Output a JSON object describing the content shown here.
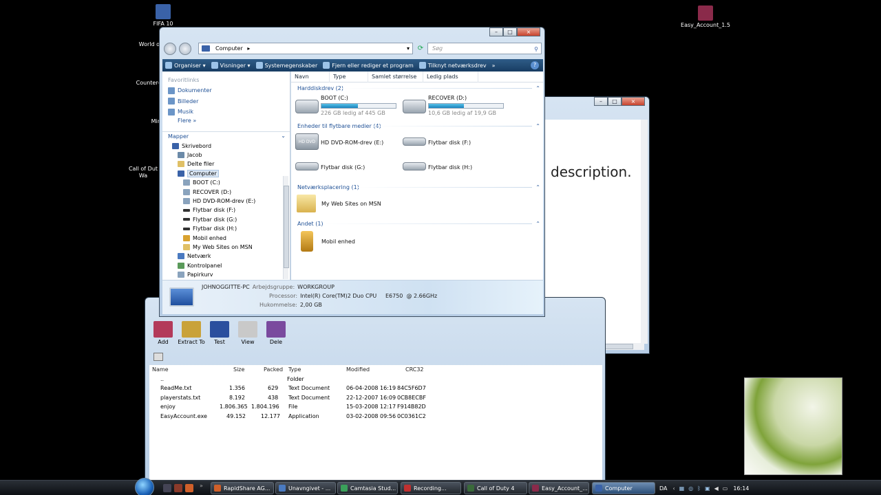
{
  "desktop": {
    "icons": [
      {
        "label": "FIFA 10",
        "color": "#3a62a8"
      },
      {
        "label": "World o",
        "color": "#6a4a22"
      },
      {
        "label": "Counter-",
        "color": "#555555"
      },
      {
        "label": "Mir",
        "color": "#334455"
      },
      {
        "label": "Call of Dut\nWa",
        "color": "#445533"
      },
      {
        "label": "Easy_Account_1.5",
        "color": "#8a2a4a"
      }
    ]
  },
  "explorer": {
    "address": "Computer",
    "search_placeholder": "Søg",
    "commands": [
      {
        "label": "Organiser ▾",
        "icon": "organize-icon"
      },
      {
        "label": "Visninger ▾",
        "icon": "views-icon"
      },
      {
        "label": "Systemegenskaber",
        "icon": "system-properties-icon"
      },
      {
        "label": "Fjern eller rediger et program",
        "icon": "uninstall-icon"
      },
      {
        "label": "Tilknyt netværksdrev",
        "icon": "map-drive-icon"
      },
      {
        "label": "»",
        "icon": "more-icon"
      }
    ],
    "nav": {
      "favorites_header": "Favoritlinks",
      "favorites": [
        "Dokumenter",
        "Billeder",
        "Musik"
      ],
      "more": "Flere  »",
      "folders_header": "Mapper",
      "tree": [
        {
          "label": "Skrivebord",
          "indent": 0
        },
        {
          "label": "Jacob",
          "indent": 1
        },
        {
          "label": "Delte filer",
          "indent": 1
        },
        {
          "label": "Computer",
          "indent": 1,
          "selected": true
        },
        {
          "label": "BOOT (C:)",
          "indent": 2
        },
        {
          "label": "RECOVER (D:)",
          "indent": 2
        },
        {
          "label": "HD DVD-ROM-drev (E:)",
          "indent": 2
        },
        {
          "label": "Flytbar disk (F:)",
          "indent": 2
        },
        {
          "label": "Flytbar disk (G:)",
          "indent": 2
        },
        {
          "label": "Flytbar disk (H:)",
          "indent": 2
        },
        {
          "label": "Mobil enhed",
          "indent": 2
        },
        {
          "label": "My Web Sites on MSN",
          "indent": 2
        },
        {
          "label": "Netværk",
          "indent": 1
        },
        {
          "label": "Kontrolpanel",
          "indent": 1
        },
        {
          "label": "Papirkurv",
          "indent": 1
        }
      ]
    },
    "columns": [
      "Navn",
      "Type",
      "Samlet størrelse",
      "Ledig plads"
    ],
    "groups": {
      "hdd": "Harddiskdrev (2)",
      "removable": "Enheder til flytbare medier (4)",
      "network": "Netværksplacering (1)",
      "other": "Andet (1)"
    },
    "drives": [
      {
        "name": "BOOT (C:)",
        "free": "226 GB ledig af 445 GB",
        "used_fraction": 0.49
      },
      {
        "name": "RECOVER (D:)",
        "free": "10,6 GB ledig af 19,9 GB",
        "used_fraction": 0.47
      }
    ],
    "removable": [
      "HD DVD-ROM-drev (E:)",
      "Flytbar disk (F:)",
      "Flytbar disk (G:)",
      "Flytbar disk (H:)"
    ],
    "dvd_badge": "HD DVD",
    "network_items": [
      "My Web Sites on MSN"
    ],
    "other_items": [
      "Mobil enhed"
    ],
    "details": {
      "pc_name": "JOHNOGGITTE-PC",
      "workgroup_label": "Arbejdsgruppe:",
      "workgroup": "WORKGROUP",
      "processor_label": "Processor:",
      "processor": "Intel(R) Core(TM)2 Duo CPU     E6750  @ 2.66GHz",
      "memory_label": "Hukommelse:",
      "memory": "2,00 GB"
    }
  },
  "document": {
    "text": "description."
  },
  "winrar": {
    "tools": [
      {
        "label": "Add",
        "color": "#b33a5a"
      },
      {
        "label": "Extract To",
        "color": "#c9a23a"
      },
      {
        "label": "Test",
        "color": "#2a4f9e"
      },
      {
        "label": "View",
        "color": "#c9c9c9"
      },
      {
        "label": "Dele",
        "color": "#7a4a9e"
      }
    ],
    "columns": [
      "Name",
      "Size",
      "Packed",
      "Type",
      "Modified",
      "CRC32"
    ],
    "rows": [
      {
        "name": "..",
        "size": "",
        "packed": "",
        "type": "Folder",
        "modified": "",
        "crc": ""
      },
      {
        "name": "ReadMe.txt",
        "size": "1.356",
        "packed": "629",
        "type": "Text Document",
        "modified": "06-04-2008 16:19",
        "crc": "84C5F6D7"
      },
      {
        "name": "playerstats.txt",
        "size": "8.192",
        "packed": "438",
        "type": "Text Document",
        "modified": "22-12-2007 16:09",
        "crc": "0CB8ECBF"
      },
      {
        "name": "enjoy",
        "size": "1.806.365",
        "packed": "1.804.196",
        "type": "File",
        "modified": "15-03-2008 12:17",
        "crc": "F914B82D"
      },
      {
        "name": "EasyAccount.exe",
        "size": "49.152",
        "packed": "12.177",
        "type": "Application",
        "modified": "03-02-2008 09:56",
        "crc": "0C0361C2"
      }
    ]
  },
  "taskbar": {
    "tasks": [
      {
        "label": "RapidShare AG...",
        "color": "#d0602a",
        "active": false
      },
      {
        "label": "Unavngivet - ...",
        "color": "#4a7ac0",
        "active": false
      },
      {
        "label": "Camtasia Stud...",
        "color": "#3aa05a",
        "active": false
      },
      {
        "label": "Recording...",
        "color": "#c03030",
        "active": false
      },
      {
        "label": "Call of Duty 4",
        "color": "#3a6a3a",
        "active": false
      },
      {
        "label": "Easy_Account_...",
        "color": "#8a2a4a",
        "active": false
      },
      {
        "label": "Computer",
        "color": "#3a62a8",
        "active": true
      }
    ],
    "language": "DA",
    "clock": "16:14"
  }
}
